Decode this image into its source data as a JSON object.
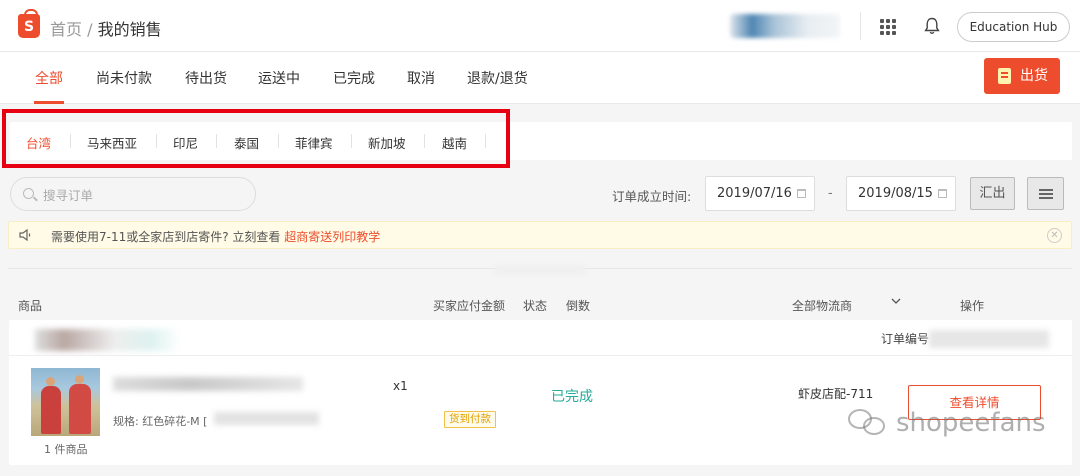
{
  "header": {
    "logo_letter": "S",
    "breadcrumb_home": "首页",
    "breadcrumb_sep": " / ",
    "breadcrumb_current": "我的销售",
    "edu_button": "Education Hub"
  },
  "status_tabs": [
    "全部",
    "尚未付款",
    "待出货",
    "运送中",
    "已完成",
    "取消",
    "退款/退货"
  ],
  "active_status_tab": "全部",
  "ship_button": "出货",
  "region_tabs": [
    "台湾",
    "马来西亚",
    "印尼",
    "泰国",
    "菲律宾",
    "新加坡",
    "越南"
  ],
  "active_region": "台湾",
  "search": {
    "placeholder": "搜寻订单"
  },
  "date_filter": {
    "label": "订单成立时间:",
    "start": "2019/07/16",
    "separator": "-",
    "end": "2019/08/15"
  },
  "export_button": "汇出",
  "notice": {
    "text": "需要使用7-11或全家店到店寄件? 立刻查看 ",
    "link": "超商寄送列印教学"
  },
  "table_headers": {
    "product": "商品",
    "buyer_amount": "买家应付金额",
    "status": "状态",
    "countdown": "倒数",
    "carrier": "全部物流商",
    "action": "操作"
  },
  "order": {
    "order_no_label": "订单编号",
    "spec_label": "规格: 红色碎花-M [",
    "quantity": "x1",
    "payment_badge": "货到付款",
    "status": "已完成",
    "carrier": "虾皮店配-711",
    "detail_button": "查看详情",
    "item_count": "1 件商品"
  },
  "watermark": "shopeefans",
  "colors": {
    "brand": "#ee4d2d",
    "completed": "#26aa99",
    "highlight_box": "#e60012"
  }
}
